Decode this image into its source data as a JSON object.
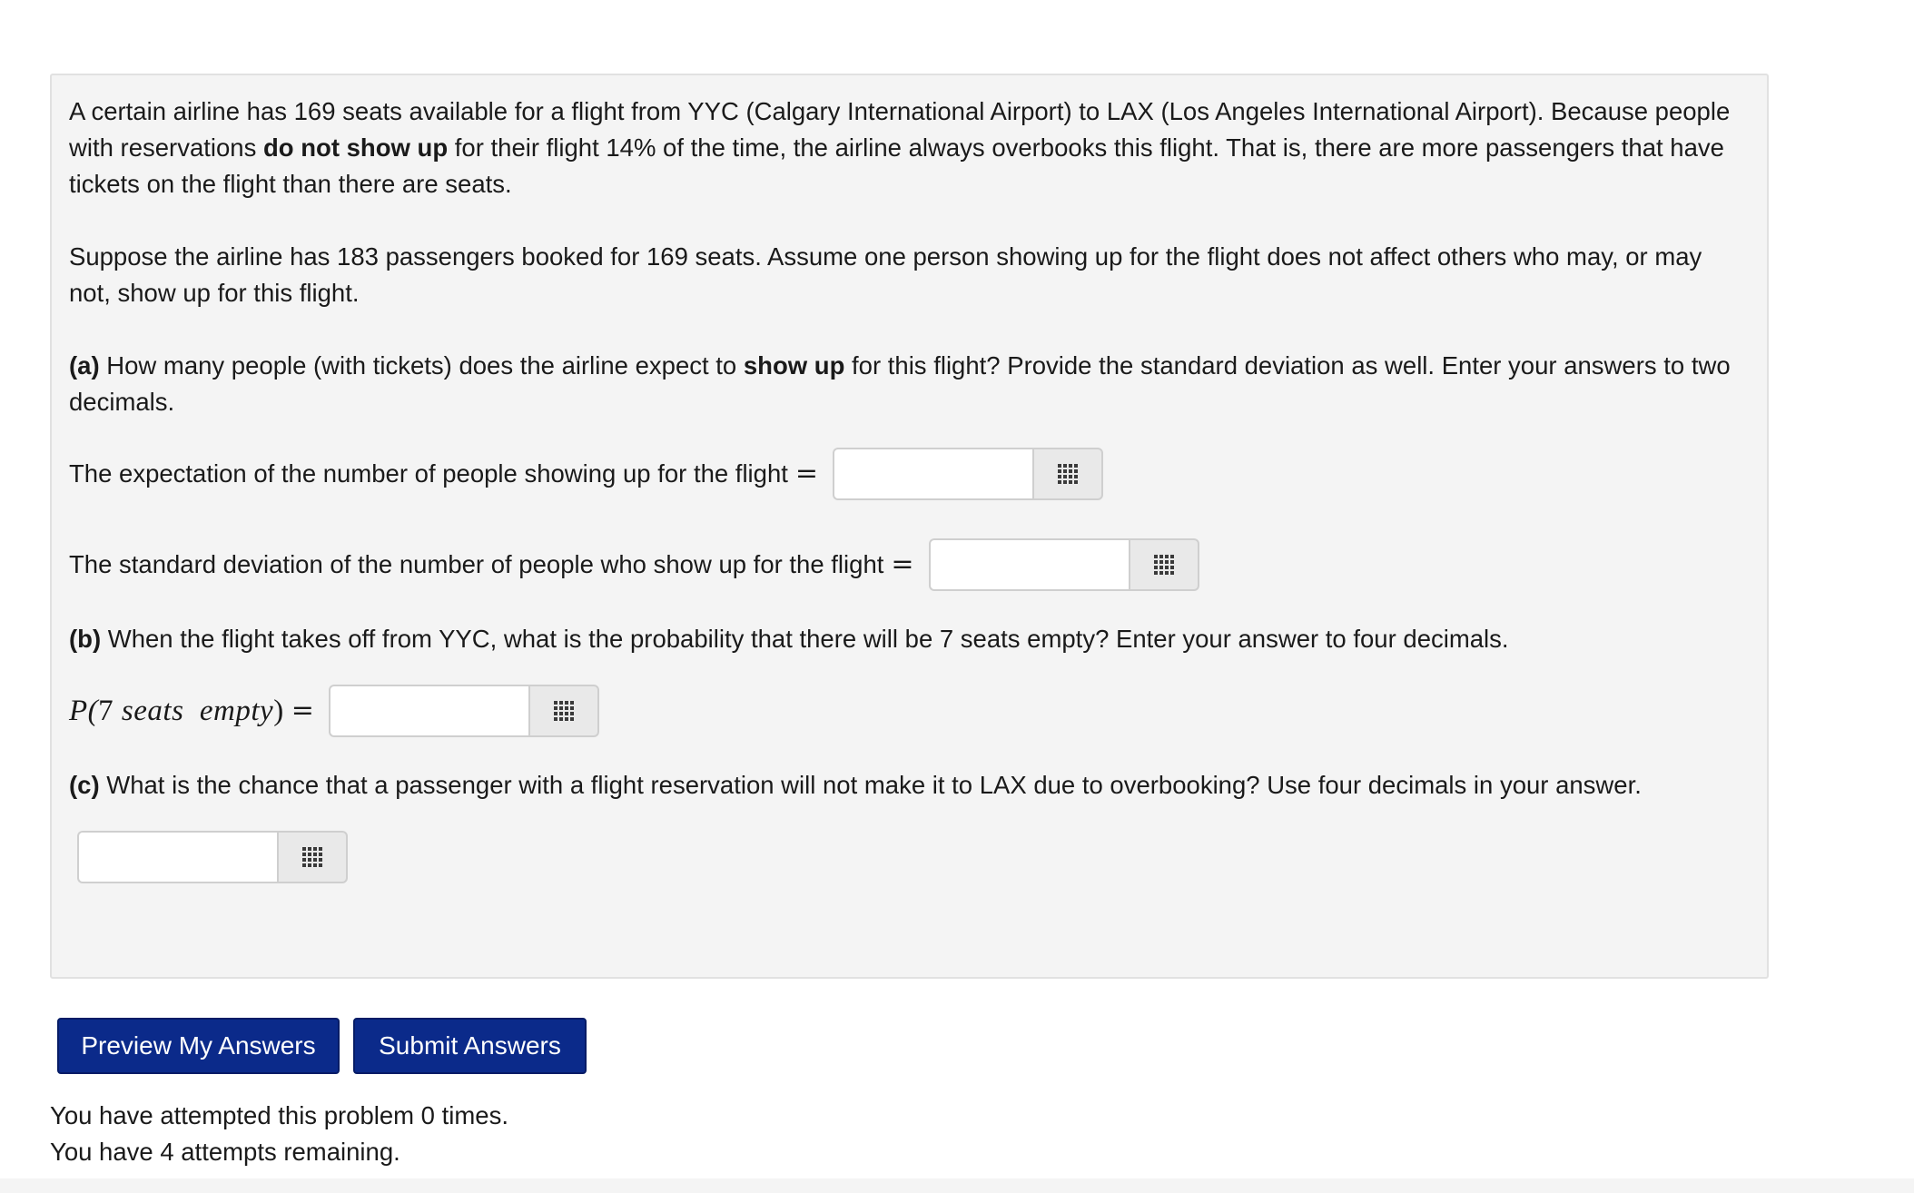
{
  "problem": {
    "intro_1": "A certain airline has 169 seats available for a flight from YYC (Calgary International Airport) to LAX (Los Angeles International Airport). Because people with reservations ",
    "intro_bold": "do not show up",
    "intro_2": " for their flight 14% of the time, the airline always overbooks this flight. That is, there are more passengers that have tickets on the flight than there are seats.",
    "setup": "Suppose the airline has 183 passengers booked for 169 seats. Assume one person showing up for the flight does not affect others who may, or may not, show up for this flight.",
    "part_a": {
      "label": "(a)",
      "text_1": " How many people (with tickets) does the airline expect to ",
      "text_bold": "show up",
      "text_2": " for this flight? Provide the standard deviation as well. Enter your answers to two decimals.",
      "expectation_label": "The expectation of the number of people showing up for the flight",
      "expectation_value": "",
      "sd_label": "The standard deviation of the number of people who show up for the flight",
      "sd_value": ""
    },
    "part_b": {
      "label": "(b)",
      "text": " When the flight takes off from YYC, what is the probability that there will be 7 seats empty? Enter your answer to four decimals.",
      "math_p": "P(",
      "math_num": "7",
      "math_words": " seats  empty",
      "math_close": ")",
      "value": ""
    },
    "part_c": {
      "label": "(c)",
      "text": " What is the chance that a passenger with a flight reservation will not make it to LAX due to overbooking? Use four decimals in your answer.",
      "value": ""
    },
    "equals": "="
  },
  "buttons": {
    "preview": "Preview My Answers",
    "submit": "Submit Answers"
  },
  "status": {
    "attempted": "You have attempted this problem 0 times.",
    "remaining": "You have 4 attempts remaining."
  },
  "icons": {
    "equation_editor": "grid-icon"
  },
  "colors": {
    "button_bg": "#0b2a8a",
    "panel_bg": "#f4f4f4"
  }
}
